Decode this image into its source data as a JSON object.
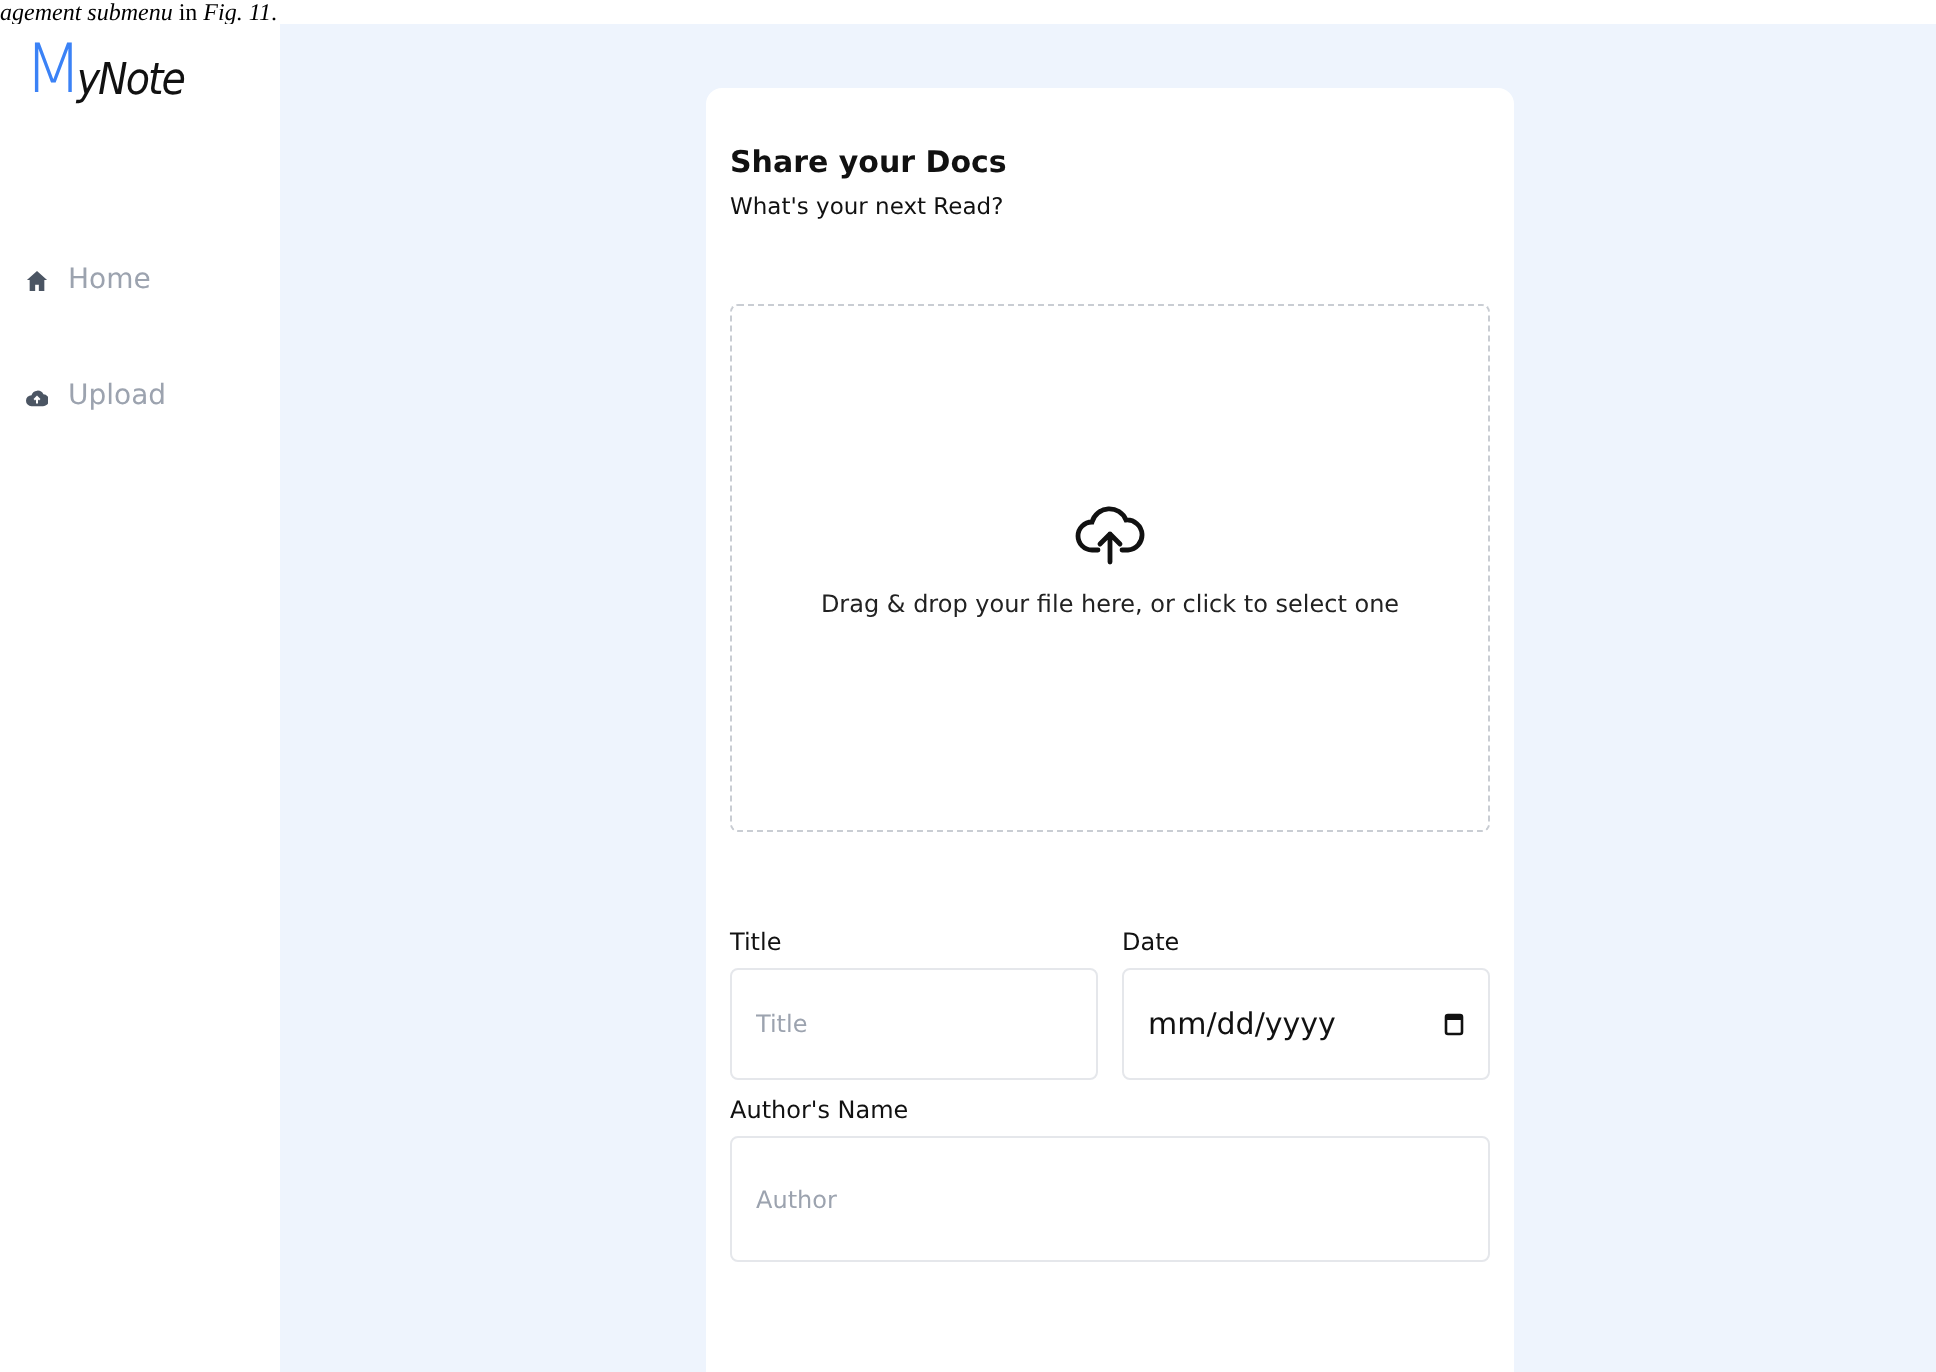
{
  "caption": "*agement submenu* in *Fig. 11*.",
  "logo": {
    "initial": "M",
    "rest": "yNote"
  },
  "sidebar": {
    "items": [
      {
        "label": "Home",
        "kind": "home"
      },
      {
        "label": "Upload",
        "kind": "upload"
      }
    ]
  },
  "card": {
    "title": "Share your Docs",
    "subtitle": "What's your next Read?",
    "dropzone": {
      "text": "Drag & drop your file here, or click to select one"
    },
    "fields": [
      {
        "label": "Title",
        "placeholder": "Title",
        "kind": "text"
      },
      {
        "label": "Date",
        "value": "mm/dd/yyyy",
        "kind": "date"
      },
      {
        "label": "Author's Name",
        "placeholder": "Author",
        "kind": "text"
      }
    ]
  }
}
